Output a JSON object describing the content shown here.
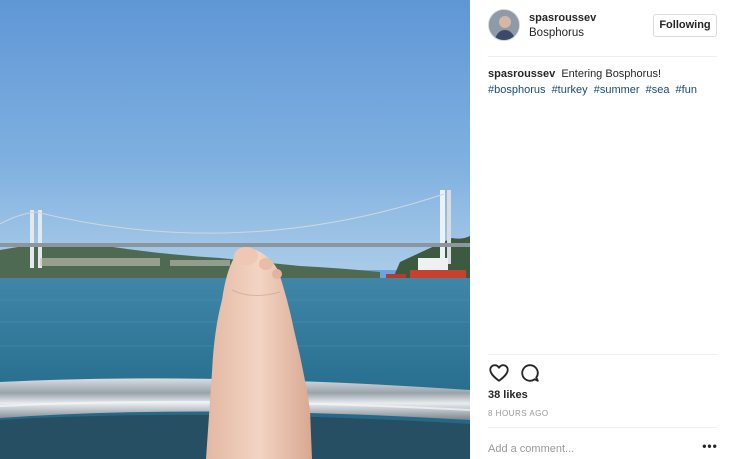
{
  "post": {
    "username": "spasroussev",
    "location": "Bosphorus",
    "follow_label": "Following",
    "caption": {
      "username": "spasroussev",
      "text": "Entering Bosphorus!",
      "hashtags": [
        "#bosphorus",
        "#turkey",
        "#summer",
        "#sea",
        "#fun"
      ]
    },
    "likes": "38 likes",
    "time": "8 HOURS AGO",
    "comment_placeholder": "Add a comment...",
    "more_label": "•••"
  },
  "icons": {
    "like": "heart-icon",
    "comment": "comment-icon",
    "more": "more-options-icon"
  },
  "colors": {
    "hashtag": "#1b4a76",
    "text": "#262626",
    "muted": "#999999",
    "border": "#dbdbdb"
  }
}
